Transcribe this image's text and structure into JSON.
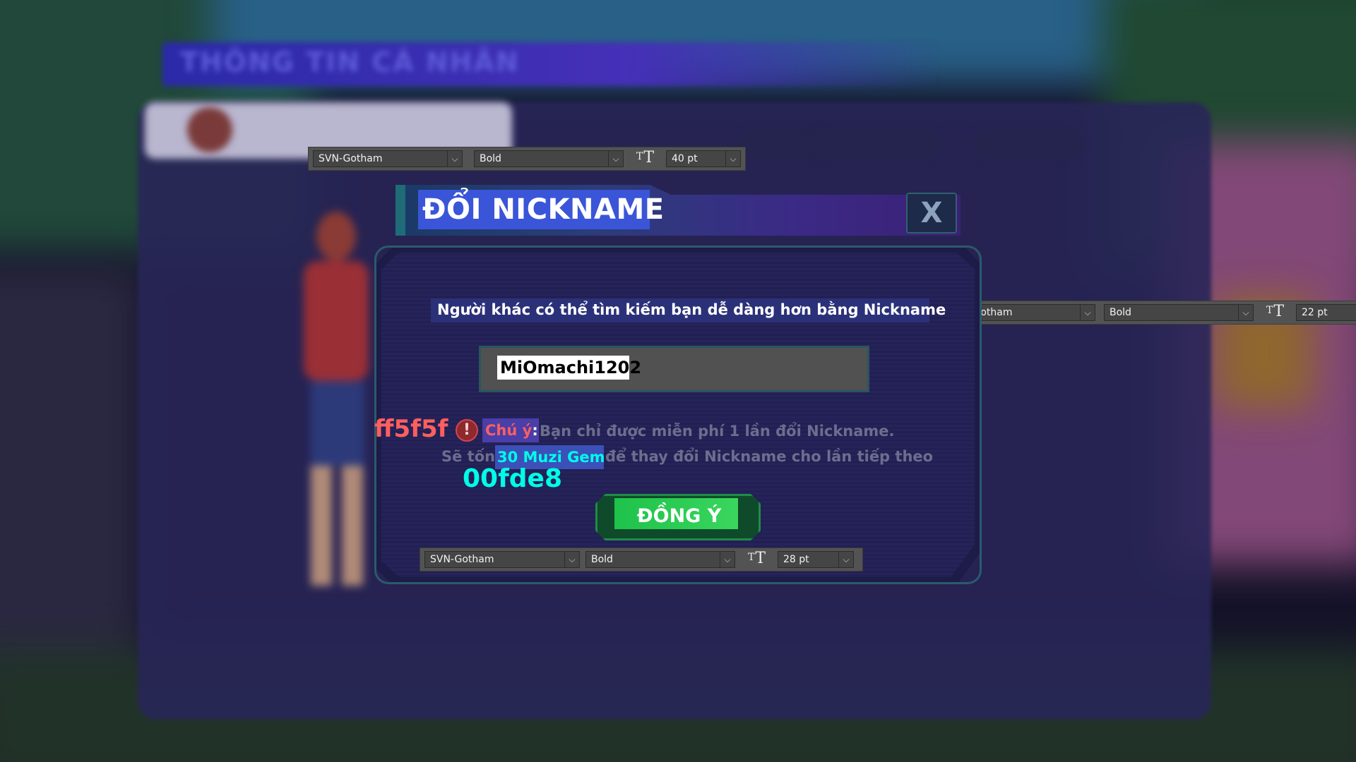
{
  "background": {
    "header_title": "THÔNG TIN CÁ NHÂN",
    "colors": {
      "backdrop": "#1b1830",
      "panel": "#28265a",
      "header": "#3b2db0"
    }
  },
  "toolbars": [
    {
      "font": "SVN-Gotham",
      "weight": "Bold",
      "size": "40 pt"
    },
    {
      "font": "SVN-Gotham",
      "weight": "Bold",
      "size": "22 pt"
    },
    {
      "font": "SVN-Gotham",
      "weight": "Bold",
      "size": "28 pt"
    }
  ],
  "dialog": {
    "title": "ĐỔI NICKNAME",
    "close_label": "X",
    "subtitle": "Người khác có thể tìm kiếm bạn dễ dàng hơn bằng Nickname",
    "nickname_value": "MiOmachi1202",
    "note_label": "Chú ý",
    "note_colon": ":",
    "note_text": "Bạn chỉ được miễn phí 1 lần đổi Nickname.",
    "cost_prefix": "Sẽ tốn",
    "cost_amount": "30 Muzi Gem",
    "cost_suffix": "để thay đổi Nickname cho lần tiếp theo",
    "confirm_label": "ĐỒNG Ý",
    "warning_icon": "exclamation-circle-icon"
  },
  "annotations": {
    "red_color_code": "ff5f5f",
    "cyan_color_code": "00fde8"
  },
  "colors": {
    "accent_red": "#ff5f5f",
    "accent_cyan": "#00fde8",
    "confirm_green": "#1ec24a",
    "title_highlight": "#3b55d8"
  }
}
